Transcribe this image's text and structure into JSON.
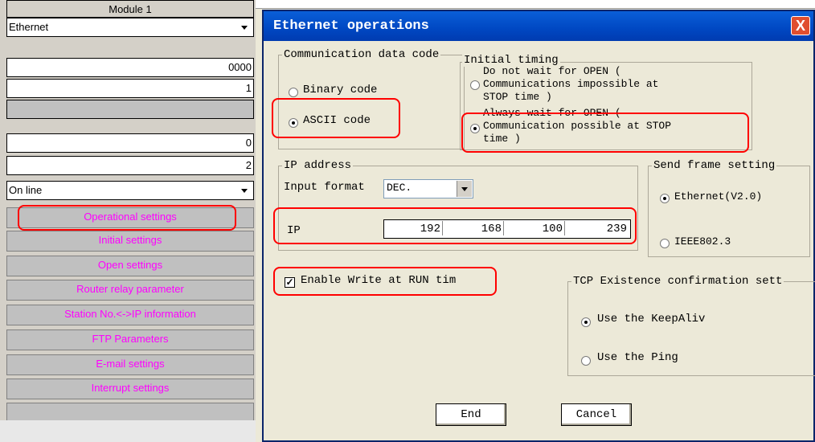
{
  "left_panel": {
    "header": "Module 1",
    "network_type": "Ethernet",
    "start_io": "0000",
    "network_no": "1",
    "group_no": "0",
    "station_no": "2",
    "mode": "On line",
    "buttons": [
      "Operational settings",
      "Initial settings",
      "Open settings",
      "Router relay parameter",
      "Station No.<->IP information",
      "FTP Parameters",
      "E-mail settings",
      "Interrupt settings"
    ]
  },
  "dialog": {
    "title": "Ethernet operations",
    "close": "X",
    "comm_code": {
      "legend": "Communication data code",
      "binary": "Binary code",
      "ascii": "ASCII code",
      "selected": "ascii"
    },
    "initial_timing": {
      "legend": "Initial timing",
      "opt1_line1": "Do not wait for OPEN (",
      "opt1_line2": "Communications impossible at",
      "opt1_line3": "STOP time )",
      "opt2_line1": "Always wait for OPEN (",
      "opt2_line2": "Communication possible at STOP",
      "opt2_line3": "time )"
    },
    "ip": {
      "legend": "IP address",
      "input_format_label": "Input format",
      "input_format_value": "DEC.",
      "ip_label": "IP",
      "octets": [
        "192",
        "168",
        "100",
        "239"
      ]
    },
    "send_frame": {
      "legend": "Send frame setting",
      "ethernet": "Ethernet(V2.0)",
      "ieee": "IEEE802.3"
    },
    "enable_write": "Enable Write at RUN tim",
    "tcp": {
      "legend": "TCP Existence confirmation sett",
      "keepalive": "Use the KeepAliv",
      "ping": "Use the Ping"
    },
    "end": "End",
    "cancel": "Cancel"
  },
  "colors": {
    "title_bar": "#0047c2",
    "highlight": "#ff0000",
    "param_button_text": "#ff00ff",
    "dialog_bg": "#ece9d8"
  }
}
